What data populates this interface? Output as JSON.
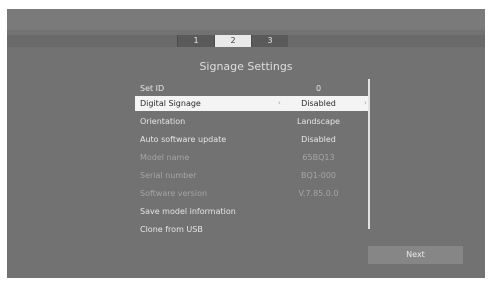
{
  "stepper": {
    "steps": [
      "1",
      "2",
      "3"
    ],
    "active": "2"
  },
  "title": "Signage Settings",
  "settings": [
    {
      "label": "Set ID",
      "value": "0"
    },
    {
      "label": "Digital Signage",
      "value": "Disabled"
    },
    {
      "label": "Orientation",
      "value": "Landscape"
    },
    {
      "label": "Auto software update",
      "value": "Disabled"
    },
    {
      "label": "Model name",
      "value": "65BQ13"
    },
    {
      "label": "Serial number",
      "value": "BQ1-000"
    },
    {
      "label": "Software version",
      "value": "V.7.85.0.0"
    },
    {
      "label": "Save model information",
      "value": ""
    },
    {
      "label": "Clone from USB",
      "value": ""
    }
  ],
  "next_label": "Next",
  "colors": {
    "background": "#727272",
    "selected_row": "#f4f4f4",
    "active_step": "#e9e9e9"
  }
}
